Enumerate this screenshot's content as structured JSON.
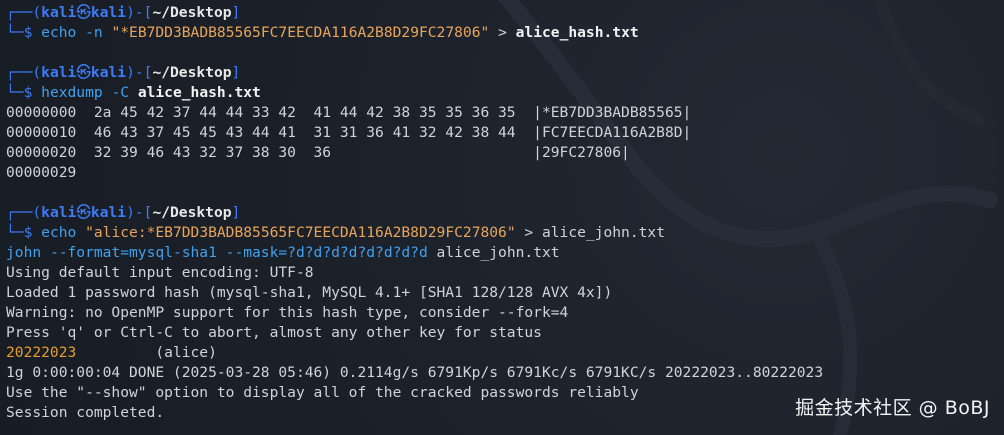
{
  "prompt": {
    "top_corner": "┌──(",
    "user": "kali",
    "at": "㉿",
    "host": "kali",
    "mid": ")-[",
    "path": "~/Desktop",
    "end": "]",
    "bottom_corner": "└─",
    "dollar": "$ "
  },
  "block1": {
    "cmd": "echo",
    "opt": " -n ",
    "str": "\"*EB7DD3BADB85565FC7EECDA116A2B8D29FC27806\"",
    "redirect": " > ",
    "file": "alice_hash.txt"
  },
  "block2": {
    "cmd": "hexdump",
    "opt": " -C ",
    "file": "alice_hash.txt",
    "output": [
      "00000000  2a 45 42 37 44 44 33 42  41 44 42 38 35 35 36 35  |*EB7DD3BADB85565|",
      "00000010  46 43 37 45 45 43 44 41  31 31 36 41 32 42 38 44  |FC7EECDA116A2B8D|",
      "00000020  32 39 46 43 32 37 38 30  36                       |29FC27806|",
      "00000029"
    ]
  },
  "block3": {
    "cmd": "echo",
    "str": " \"alice:*EB7DD3BADB85565FC7EECDA116A2B8D29FC27806\"",
    "redirect": " > ",
    "file": "alice_john.txt",
    "john_cmd": "john",
    "john_opt1": " --format=mysql-sha1 --mask=",
    "john_mask": "?d?d?d?d?d?d?d?d",
    "john_file": " alice_john.txt",
    "output": [
      "Using default input encoding: UTF-8",
      "Loaded 1 password hash (mysql-sha1, MySQL 4.1+ [SHA1 128/128 AVX 4x])",
      "Warning: no OpenMP support for this hash type, consider --fork=4",
      "Press 'q' or Ctrl-C to abort, almost any other key for status"
    ],
    "cracked_password": "20222023",
    "cracked_user": "         (alice)",
    "status_line": "1g 0:00:00:04 DONE (2025-03-28 05:46) 0.2114g/s 6791Kp/s 6791Kc/s 6791KC/s 20222023..80222023",
    "show_line": "Use the \"--show\" option to display all of the cracked passwords reliably",
    "session_line": "Session completed."
  },
  "watermark": "掘金技术社区 @ BoBJ"
}
